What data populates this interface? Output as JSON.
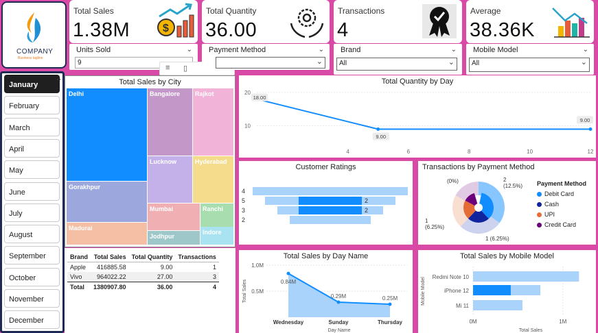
{
  "logo": {
    "name": "COMPANY",
    "tagline": "Business tagline"
  },
  "kpis": [
    {
      "label": "Total Sales",
      "value": "1.38M"
    },
    {
      "label": "Total Quantity",
      "value": "36.00"
    },
    {
      "label": "Transactions",
      "value": "4"
    },
    {
      "label": "Average",
      "value": "38.36K"
    }
  ],
  "slicers": {
    "units_sold": {
      "title": "Units Sold",
      "value": "9"
    },
    "payment_method": {
      "title": "Payment Method",
      "value": ""
    },
    "brand": {
      "title": "Brand",
      "value": "All"
    },
    "mobile_model": {
      "title": "Mobile Model",
      "value": "All"
    }
  },
  "months": [
    "January",
    "February",
    "March",
    "April",
    "May",
    "June",
    "July",
    "August",
    "September",
    "October",
    "November",
    "December"
  ],
  "selected_month": "January",
  "treemap": {
    "title": "Total Sales by City",
    "cells": [
      {
        "label": "Delhi",
        "color": "#118dff"
      },
      {
        "label": "Bangalore",
        "color": "#c497c9"
      },
      {
        "label": "Rajkot",
        "color": "#f2b3d9"
      },
      {
        "label": "Lucknow",
        "color": "#c5b1ea"
      },
      {
        "label": "Hyderabad",
        "color": "#f5dc8c"
      },
      {
        "label": "Gorakhpur",
        "color": "#9ba7dd"
      },
      {
        "label": "Mumbai",
        "color": "#f0b0b3"
      },
      {
        "label": "Ranchi",
        "color": "#a8ddb0"
      },
      {
        "label": "Jodhpur",
        "color": "#9ec7c9"
      },
      {
        "label": "Madurai",
        "color": "#f4bfa4"
      },
      {
        "label": "Indore",
        "color": "#a9e3f2"
      }
    ]
  },
  "qty_by_day": {
    "title": "Total Quantity by Day",
    "chart_data": {
      "type": "line",
      "x": [
        1,
        5,
        12
      ],
      "y": [
        18.0,
        9.0,
        9.0
      ],
      "data_labels": [
        "18.00",
        "9.00",
        "9.00"
      ],
      "xticks": [
        "4",
        "6",
        "8",
        "10",
        "12"
      ],
      "yticks": [
        "10",
        "20"
      ],
      "xlim": [
        1,
        12
      ],
      "ylim": [
        5,
        21
      ]
    }
  },
  "ratings": {
    "title": "Customer Ratings",
    "chart_data": {
      "type": "bar",
      "categories": [
        "4",
        "5",
        "3",
        "2"
      ],
      "values": [
        0,
        2,
        2,
        0
      ],
      "value_labels": [
        "",
        "2",
        "2",
        ""
      ]
    }
  },
  "payment": {
    "title": "Transactions by Payment Method",
    "legend_title": "Payment Method",
    "legend": [
      {
        "label": "Debit Card",
        "color": "#118dff"
      },
      {
        "label": "Cash",
        "color": "#12239e"
      },
      {
        "label": "UPI",
        "color": "#e66c37"
      },
      {
        "label": "Credit Card",
        "color": "#6b007b"
      }
    ],
    "labels": [
      "(0%)",
      "2\n(12.5%)",
      "1\n(6.25%)",
      "1 (6.25%)"
    ],
    "chart_data": {
      "type": "pie",
      "categories": [
        "Debit Card",
        "Cash",
        "UPI",
        "Credit Card"
      ],
      "values": [
        2,
        1,
        1,
        0
      ]
    }
  },
  "brand_table": {
    "headers": [
      "Brand",
      "Total Sales",
      "Total Quantity",
      "Transactions"
    ],
    "rows": [
      [
        "Apple",
        "416885.58",
        "9.00",
        "1"
      ],
      [
        "Vivo",
        "964022.22",
        "27.00",
        "3"
      ]
    ],
    "total": [
      "Total",
      "1380907.80",
      "36.00",
      "4"
    ]
  },
  "sales_by_dayname": {
    "title": "Total Sales by Day Name",
    "chart_data": {
      "type": "area",
      "categories": [
        "Wednesday",
        "Sunday",
        "Thursday"
      ],
      "values": [
        0.84,
        0.29,
        0.25
      ],
      "data_labels": [
        "0.84M",
        "0.29M",
        "0.25M"
      ],
      "yticks": [
        "0.5M",
        "1.0M"
      ],
      "xlabel": "Day Name",
      "ylabel": "Total Sales",
      "ylim": [
        0,
        1.0
      ]
    }
  },
  "sales_by_model": {
    "title": "Total Sales by Mobile Model",
    "chart_data": {
      "type": "bar",
      "categories": [
        "Redmi Note 10",
        "iPhone 12",
        "Mi 11"
      ],
      "values": [
        1.18,
        0.75,
        0.55
      ],
      "highlight": [
        0,
        0.42,
        0
      ],
      "xticks": [
        "0M",
        "1M"
      ],
      "xlabel": "Total Sales",
      "ylabel": "Mobile Model",
      "xlim": [
        0,
        1.3
      ]
    }
  }
}
